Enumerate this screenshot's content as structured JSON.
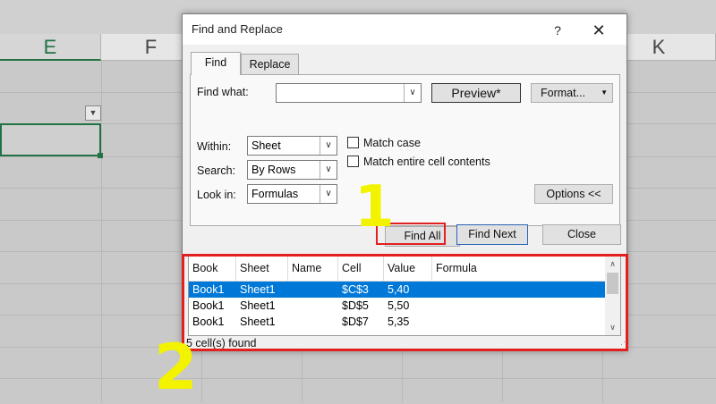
{
  "sheet": {
    "columns": [
      "E",
      "F",
      "K"
    ],
    "active_column": "E"
  },
  "dialog": {
    "title": "Find and Replace",
    "help": "?",
    "close_x": "✕",
    "tabs": [
      {
        "label": "Find",
        "active": true
      },
      {
        "label": "Replace",
        "active": false
      }
    ],
    "find_what_label": "Find what:",
    "find_what_value": "",
    "preview_label": "Preview*",
    "format_label": "Format...",
    "within_label": "Within:",
    "within_value": "Sheet",
    "search_label": "Search:",
    "search_value": "By Rows",
    "lookin_label": "Look in:",
    "lookin_value": "Formulas",
    "match_case_label": "Match case",
    "match_case_checked": false,
    "match_entire_label": "Match entire cell contents",
    "match_entire_checked": false,
    "options_label": "Options <<",
    "find_all_label": "Find All",
    "find_next_label": "Find Next",
    "close_label": "Close"
  },
  "results": {
    "columns": [
      "Book",
      "Sheet",
      "Name",
      "Cell",
      "Value",
      "Formula"
    ],
    "rows": [
      {
        "book": "Book1",
        "sheet": "Sheet1",
        "name": "",
        "cell": "$C$3",
        "value": "5,40",
        "formula": "",
        "selected": true
      },
      {
        "book": "Book1",
        "sheet": "Sheet1",
        "name": "",
        "cell": "$D$5",
        "value": "5,50",
        "formula": "",
        "selected": false
      },
      {
        "book": "Book1",
        "sheet": "Sheet1",
        "name": "",
        "cell": "$D$7",
        "value": "5,35",
        "formula": "",
        "selected": false
      }
    ],
    "status": "5 cell(s) found"
  },
  "annotations": {
    "step1": "1",
    "step2": "2",
    "highlight_color": "#e22020",
    "number_color": "#f3f300"
  },
  "colors": {
    "excel_green": "#217346",
    "selection_blue": "#0078d7"
  }
}
